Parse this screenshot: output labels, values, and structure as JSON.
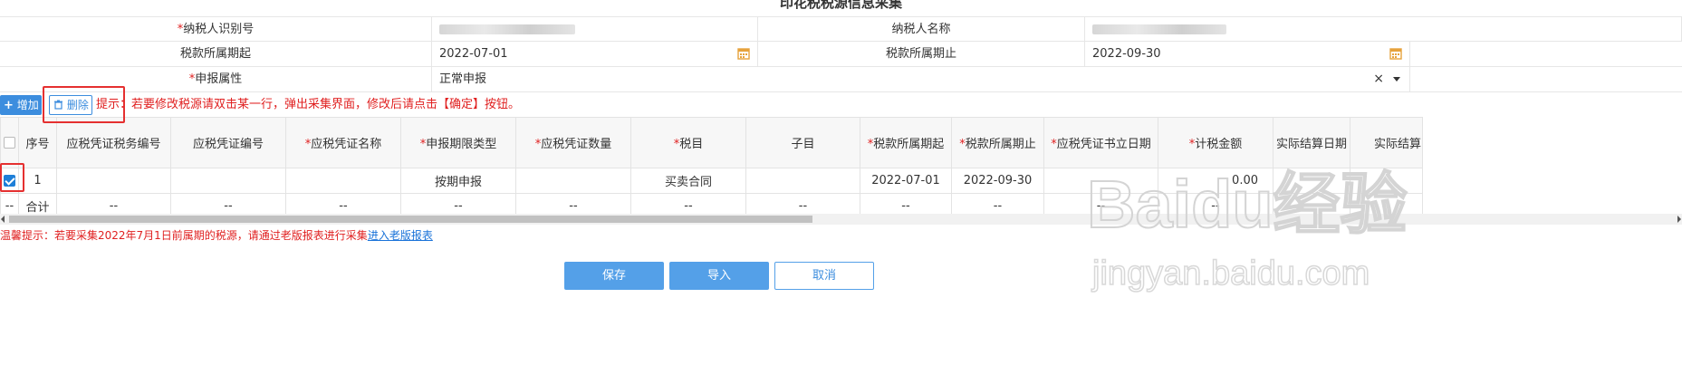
{
  "title": "印花税税源信息采集",
  "form": {
    "taxpayer_id_label": "纳税人识别号",
    "taxpayer_name_label": "纳税人名称",
    "period_start_label": "税款所属期起",
    "period_start_value": "2022-07-01",
    "period_end_label": "税款所属期止",
    "period_end_value": "2022-09-30",
    "declare_attr_label": "申报属性",
    "declare_attr_value": "正常申报",
    "clear_symbol": "×"
  },
  "toolbar": {
    "add_label": "增加",
    "delete_label": "删除",
    "hint": "提示：若要修改税源请双击某一行，弹出采集界面，修改后请点击【确定】按钮。"
  },
  "table": {
    "columns": [
      "序号",
      "应税凭证税务编号",
      "应税凭证编号",
      "应税凭证名称",
      "申报期限类型",
      "应税凭证数量",
      "税目",
      "子目",
      "税款所属期起",
      "税款所属期止",
      "应税凭证书立日期",
      "计税金额",
      "实际结算日期",
      "实际结算"
    ],
    "rows": [
      {
        "checked": true,
        "cells": [
          "1",
          "",
          "",
          "",
          "按期申报",
          "",
          "买卖合同",
          "",
          "2022-07-01",
          "2022-09-30",
          "",
          "0.00",
          "",
          ""
        ]
      }
    ],
    "total_row": [
      "合计",
      "--",
      "--",
      "--",
      "--",
      "--",
      "--",
      "--",
      "--",
      "--",
      "--",
      "--",
      "--",
      "--"
    ],
    "total_lead": "--"
  },
  "warm_tip": {
    "text": "温馨提示：若要采集2022年7月1日前属期的税源，请通过老版报表进行采集",
    "link": "进入老版报表"
  },
  "buttons": {
    "save": "保存",
    "import": "导入",
    "cancel": "取消"
  },
  "watermark": {
    "brand": "Baidu经验",
    "url": "jingyan.baidu.com"
  },
  "colors": {
    "accent": "#3c8dde",
    "required": "#e02020",
    "highlight_box": "#e53030"
  }
}
